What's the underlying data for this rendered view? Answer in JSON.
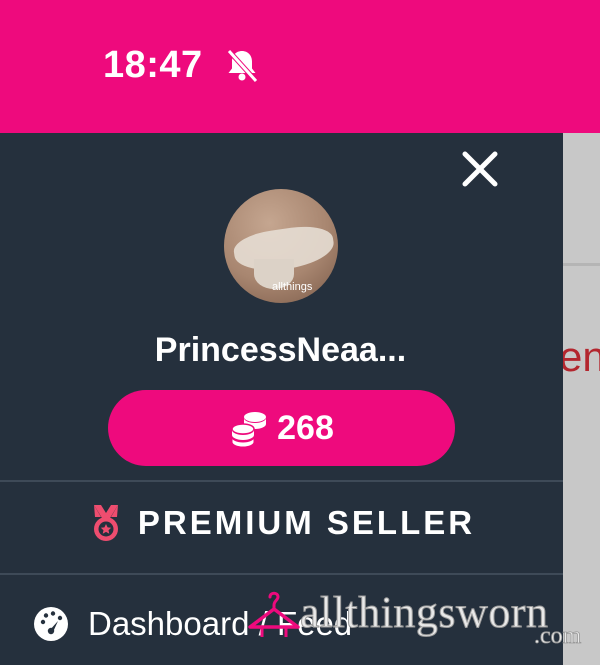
{
  "status_bar": {
    "time": "18:47",
    "icon": "bell-slash-icon"
  },
  "menu": {
    "close_icon": "close-icon",
    "username": "PrincessNeaa...",
    "tokens": {
      "count": "268",
      "icon": "coins-stack-icon"
    },
    "badge": {
      "label": "PREMIUM SELLER",
      "icon": "medal-icon"
    },
    "items": [
      {
        "label": "Dashboard / Feed",
        "icon": "gauge-icon"
      }
    ]
  },
  "avatar_watermark": "allthings",
  "watermark": {
    "main": "allthingsworn",
    "sub": ".com",
    "icon": "hanger-icon"
  },
  "colors": {
    "brand": "#ee0a7d",
    "drawer": "#25303d",
    "text": "#ffffff",
    "accent_red": "#b3262e"
  },
  "background_peek_text": "en"
}
